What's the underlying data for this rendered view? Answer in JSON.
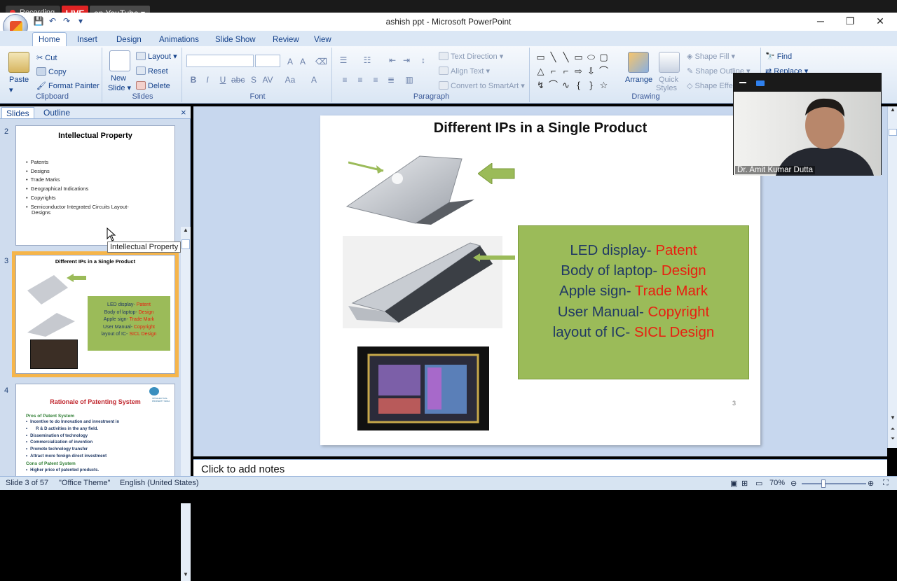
{
  "recording": {
    "label": "Recording",
    "live_badge": "LIVE",
    "platform": "on YouTube"
  },
  "window": {
    "title": "ashish ppt - Microsoft PowerPoint"
  },
  "ribbon_tabs": [
    "Home",
    "Insert",
    "Design",
    "Animations",
    "Slide Show",
    "Review",
    "View"
  ],
  "clipboard": {
    "paste": "Paste",
    "cut": "Cut",
    "copy": "Copy",
    "format_painter": "Format Painter",
    "label": "Clipboard"
  },
  "slides_group": {
    "new_slide_1": "New",
    "new_slide_2": "Slide",
    "layout": "Layout",
    "reset": "Reset",
    "delete": "Delete",
    "label": "Slides"
  },
  "font_group": {
    "label": "Font"
  },
  "paragraph_group": {
    "text_direction": "Text Direction",
    "align_text": "Align Text",
    "convert_smartart": "Convert to SmartArt",
    "label": "Paragraph"
  },
  "drawing_group": {
    "arrange": "Arrange",
    "quick_styles_1": "Quick",
    "quick_styles_2": "Styles",
    "shape_fill": "Shape Fill",
    "shape_outline": "Shape Outline",
    "shape_effects": "Shape Effe",
    "label": "Drawing"
  },
  "editing_group": {
    "find": "Find",
    "replace": "Replace"
  },
  "panel": {
    "tab_slides": "Slides",
    "tab_outline": "Outline",
    "close": "×",
    "thumbs": [
      {
        "num": "2",
        "title": "Intellectual Property",
        "items": [
          "Patents",
          "Designs",
          "Trade Marks",
          "Geographical Indications",
          "Copyrights",
          "Semiconductor Integrated  Circuits Layout-",
          "Designs"
        ]
      },
      {
        "num": "3",
        "title": "Different IPs in a Single  Product",
        "lines": [
          {
            "label": "LED display-",
            "value": "Patent"
          },
          {
            "label": "Body of laptop-",
            "value": "Design"
          },
          {
            "label": "Apple sign-",
            "value": "Trade Mark"
          },
          {
            "label": "User Manual-",
            "value": "Copyright"
          },
          {
            "label": "layout of IC-",
            "value": "SICL Design"
          }
        ]
      },
      {
        "num": "4",
        "title": "Rationale of Patenting System",
        "pros_heading": "Pros of Patent System",
        "pros": [
          "Incentive to do Innovation and investment in",
          "R & D activities in the any field.",
          "Dissemination of technology",
          "Commercialization of invention",
          "Promote technology transfer",
          "Attract more foreign direct investment"
        ],
        "cons_heading": "Cons of Patent System",
        "cons": [
          "Higher price of patented products."
        ],
        "logo_text": "INTELLECTUAL PROPERTY INDIA"
      }
    ],
    "tooltip": "Intellectual Property"
  },
  "slide": {
    "title": "Different IPs in a Single Product",
    "lines": [
      {
        "label": "LED display- ",
        "value": "Patent"
      },
      {
        "label": "Body of laptop- ",
        "value": "Design"
      },
      {
        "label": "Apple sign- ",
        "value": "Trade Mark"
      },
      {
        "label": "User Manual- ",
        "value": "Copyright"
      },
      {
        "label": "layout of IC- ",
        "value": "SICL Design"
      }
    ],
    "page_number": "3"
  },
  "notes": {
    "placeholder": "Click to add notes"
  },
  "status": {
    "slide": "Slide 3 of 57",
    "theme": "\"Office Theme\"",
    "language": "English (United States)",
    "zoom": "70%"
  },
  "webcam": {
    "name": "Dr. Amit Kumar Dutta"
  },
  "colors": {
    "accent_red": "#e81f10",
    "box_green": "#9bbb59",
    "text_navy": "#203864",
    "ribbon_blue": "#dbe7f5"
  }
}
